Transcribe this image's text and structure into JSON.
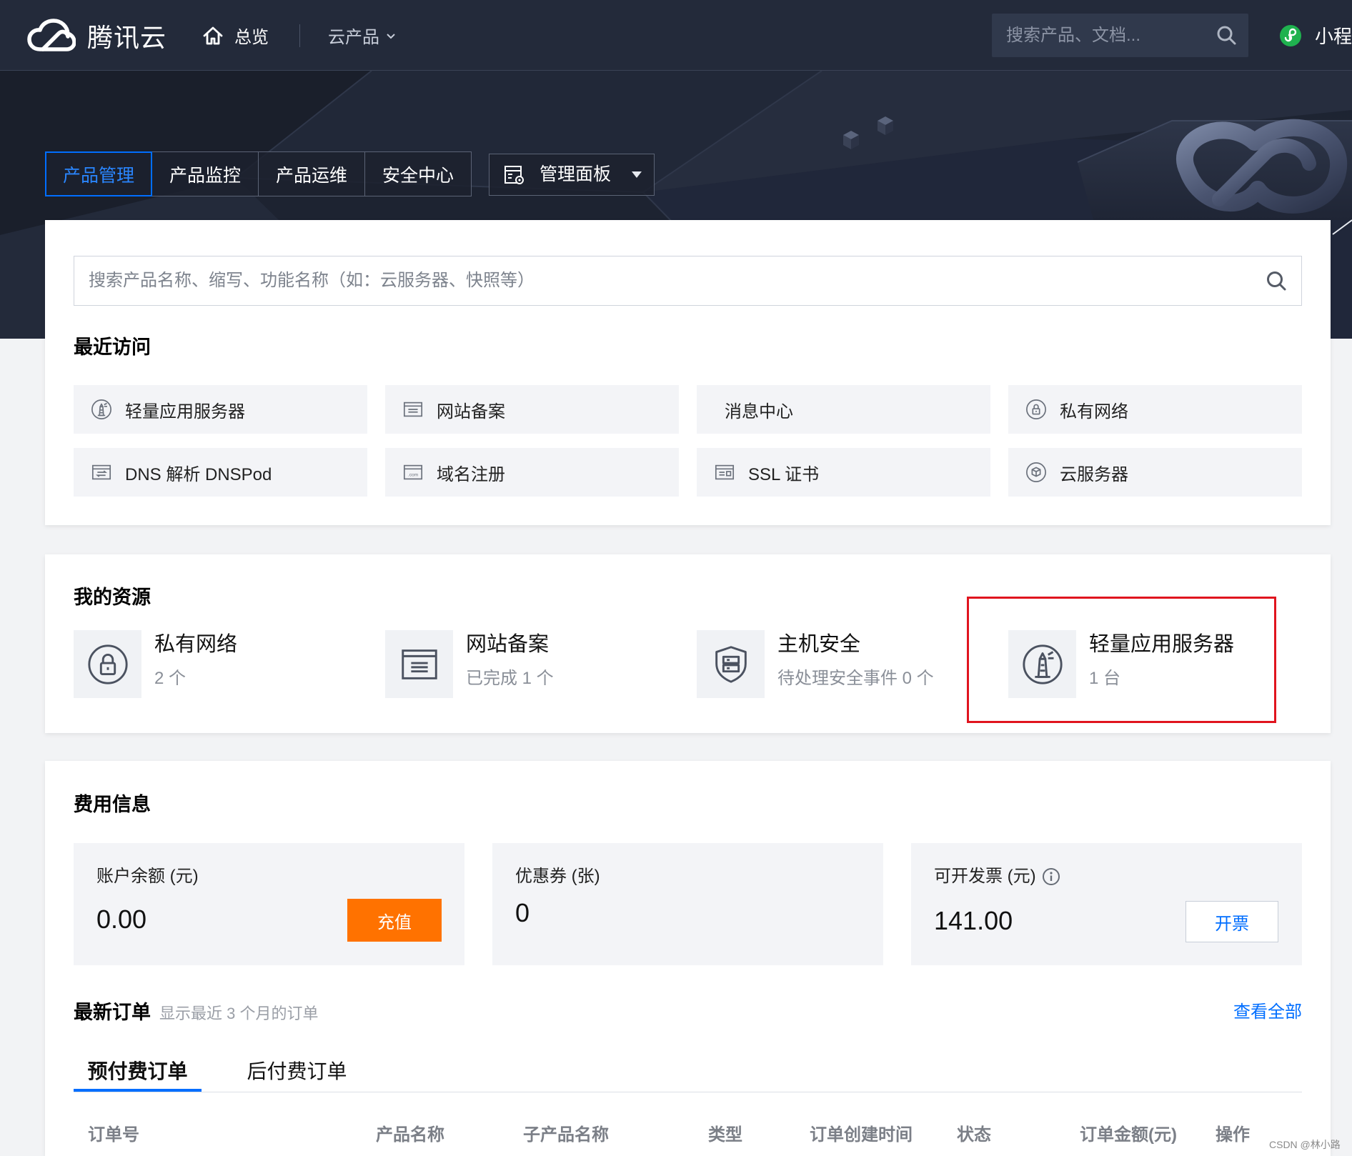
{
  "colors": {
    "nav_background": "#232a3a",
    "accent": "#006eff",
    "recharge_button": "#ff7200",
    "highlight_box": "#e0141e"
  },
  "topnav": {
    "brand": "腾讯云",
    "logo_icon": "tencent-cloud-logo-icon",
    "overview": "总览",
    "overview_icon": "home-icon",
    "products": "云产品",
    "search_placeholder": "搜索产品、文档...",
    "search_icon": "search-icon",
    "user_icon": "mini-program-icon",
    "user_name": "小程"
  },
  "console_tabs": [
    {
      "label": "产品管理",
      "active": true
    },
    {
      "label": "产品监控",
      "active": false
    },
    {
      "label": "产品运维",
      "active": false
    },
    {
      "label": "安全中心",
      "active": false
    }
  ],
  "panel_menu": {
    "label": "管理面板",
    "icon": "dashboard-settings-icon"
  },
  "product_search": {
    "placeholder": "搜索产品名称、缩写、功能名称（如：云服务器、快照等）"
  },
  "recent": {
    "title": "最近访问",
    "items": [
      {
        "label": "轻量应用服务器",
        "icon": "lighthouse-icon"
      },
      {
        "label": "网站备案",
        "icon": "icp-filing-icon"
      },
      {
        "label": "消息中心"
      },
      {
        "label": "私有网络",
        "icon": "vpc-lock-icon"
      },
      {
        "label": "DNS 解析 DNSPod",
        "icon": "dns-icon"
      },
      {
        "label": "域名注册",
        "icon": "domain-icon",
        "icon_text": ".com"
      },
      {
        "label": "SSL 证书",
        "icon": "ssl-certificate-icon"
      },
      {
        "label": "云服务器",
        "icon": "cvm-cube-icon"
      }
    ]
  },
  "resources": {
    "title": "我的资源",
    "items": [
      {
        "title": "私有网络",
        "detail": "2 个",
        "icon": "vpc-lock-icon"
      },
      {
        "title": "网站备案",
        "detail": "已完成 1 个",
        "icon": "icp-filing-icon"
      },
      {
        "title": "主机安全",
        "detail": "待处理安全事件 0 个",
        "icon": "host-security-shield-icon"
      },
      {
        "title": "轻量应用服务器",
        "detail": "1 台",
        "icon": "lighthouse-icon",
        "highlighted": true
      }
    ]
  },
  "billing": {
    "title": "费用信息",
    "balance": {
      "label": "账户余额 (元)",
      "value": "0.00",
      "action": "充值"
    },
    "coupons": {
      "label": "优惠券 (张)",
      "value": "0"
    },
    "invoice": {
      "label": "可开发票 (元)",
      "value": "141.00",
      "action": "开票",
      "info_icon": "info-icon"
    }
  },
  "orders": {
    "title": "最新订单",
    "subtitle": "显示最近 3 个月的订单",
    "view_all": "查看全部",
    "tabs": [
      {
        "label": "预付费订单",
        "active": true
      },
      {
        "label": "后付费订单",
        "active": false
      }
    ],
    "columns": [
      "订单号",
      "产品名称",
      "子产品名称",
      "类型",
      "订单创建时间",
      "状态",
      "订单金额(元)",
      "操作"
    ]
  },
  "watermark": "CSDN @林小路"
}
